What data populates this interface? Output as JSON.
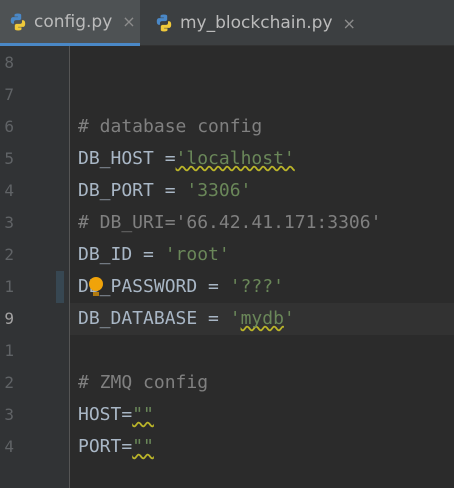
{
  "tabs": [
    {
      "label": "config.py",
      "active": true,
      "icon": "python-icon",
      "close": "×"
    },
    {
      "label": "my_blockchain.py",
      "active": false,
      "icon": "python-icon",
      "close": "×"
    }
  ],
  "lines": [
    {
      "num": "8",
      "tokens": []
    },
    {
      "num": "7",
      "tokens": []
    },
    {
      "num": "6",
      "tokens": [
        {
          "t": "# database config",
          "c": "comment"
        }
      ]
    },
    {
      "num": "5",
      "tokens": [
        {
          "t": "DB_HOST =",
          "c": "op"
        },
        {
          "t": "'localhost'",
          "c": "string",
          "squiggle": true
        }
      ]
    },
    {
      "num": "4",
      "tokens": [
        {
          "t": "DB_PORT = ",
          "c": "op"
        },
        {
          "t": "'3306'",
          "c": "string"
        }
      ]
    },
    {
      "num": "3",
      "tokens": [
        {
          "t": "# DB_URI='66.42.41.171:3306'",
          "c": "comment"
        }
      ]
    },
    {
      "num": "2",
      "tokens": [
        {
          "t": "DB_ID = ",
          "c": "op"
        },
        {
          "t": "'root'",
          "c": "string"
        }
      ]
    },
    {
      "num": "1",
      "tokens": [
        {
          "t": "DB_PASSWORD = ",
          "c": "op"
        },
        {
          "t": "'???'",
          "c": "string"
        }
      ],
      "bulb": true,
      "changed": true
    },
    {
      "num": "9",
      "tokens": [
        {
          "t": "DB_DATABASE = ",
          "c": "op"
        },
        {
          "t": "'",
          "c": "string"
        },
        {
          "t": "mydb",
          "c": "string",
          "squiggle": true
        },
        {
          "t": "'",
          "c": "string"
        }
      ],
      "current": true
    },
    {
      "num": "1",
      "tokens": []
    },
    {
      "num": "2",
      "tokens": [
        {
          "t": "# ZMQ config",
          "c": "comment"
        }
      ]
    },
    {
      "num": "3",
      "tokens": [
        {
          "t": "HOST=",
          "c": "op"
        },
        {
          "t": "\"\"",
          "c": "string",
          "squiggle": true
        }
      ]
    },
    {
      "num": "4",
      "tokens": [
        {
          "t": "PORT=",
          "c": "op"
        },
        {
          "t": "\"\"",
          "c": "string",
          "squiggle": true
        }
      ]
    },
    {
      "num": "",
      "tokens": []
    }
  ],
  "colors": {
    "comment": "#808080",
    "string": "#6a8759",
    "identifier": "#a9b7c6",
    "accent": "#4a88c7"
  }
}
